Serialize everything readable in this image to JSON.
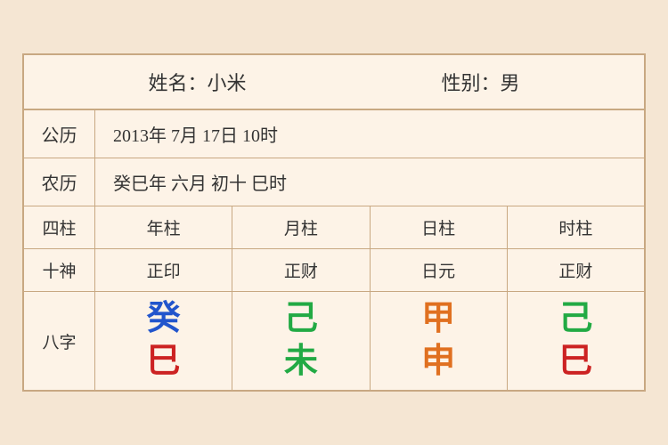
{
  "header": {
    "name_label": "姓名：小米",
    "gender_label": "性别：男"
  },
  "solar": {
    "label": "公历",
    "value": "2013年 7月 17日 10时"
  },
  "lunar": {
    "label": "农历",
    "value": "癸巳年 六月 初十 巳时"
  },
  "pillars": {
    "label": "四柱",
    "columns": [
      "年柱",
      "月柱",
      "日柱",
      "时柱"
    ]
  },
  "shishen": {
    "label": "十神",
    "columns": [
      "正印",
      "正财",
      "日元",
      "正财"
    ]
  },
  "bazhi": {
    "label": "八字",
    "columns": [
      {
        "top": "癸",
        "bottom": "巳",
        "top_color": "color-blue",
        "bottom_color": "color-red"
      },
      {
        "top": "己",
        "bottom": "未",
        "top_color": "color-green",
        "bottom_color": "color-green"
      },
      {
        "top": "甲",
        "bottom": "申",
        "top_color": "color-orange",
        "bottom_color": "color-orange"
      },
      {
        "top": "己",
        "bottom": "巳",
        "top_color": "color-green2",
        "bottom_color": "color-red"
      }
    ]
  }
}
